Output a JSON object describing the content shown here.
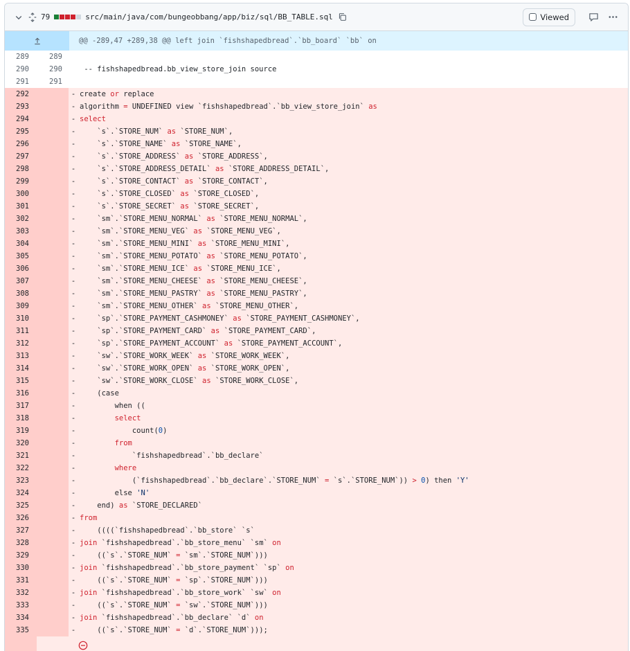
{
  "file": {
    "changed_count": "79",
    "diffstat_colors": [
      "#1a7f37",
      "#cf222e",
      "#cf222e",
      "#cf222e",
      "#d1d9e0"
    ],
    "path": "src/main/java/com/bungeobbang/app/biz/sql/BB_TABLE.sql",
    "viewed_label": "Viewed"
  },
  "hunk": "@@ -289,47 +289,38 @@ left join `fishshapedbread`.`bb_board` `bb` on",
  "context_lines": [
    {
      "old": "289",
      "new": "289",
      "text": ""
    },
    {
      "old": "290",
      "new": "290",
      "text": "-- fishshapedbread.bb_view_store_join source"
    },
    {
      "old": "291",
      "new": "291",
      "text": ""
    }
  ],
  "deleted_lines": [
    {
      "num": "292",
      "tokens": [
        [
          "p",
          "create "
        ],
        [
          "k",
          "or"
        ],
        [
          "p",
          " replace"
        ]
      ]
    },
    {
      "num": "293",
      "tokens": [
        [
          "p",
          "algorithm "
        ],
        [
          "k",
          "="
        ],
        [
          "p",
          " UNDEFINED view `fishshapedbread`.`bb_view_store_join` "
        ],
        [
          "k",
          "as"
        ]
      ]
    },
    {
      "num": "294",
      "tokens": [
        [
          "k",
          "select"
        ]
      ]
    },
    {
      "num": "295",
      "tokens": [
        [
          "p",
          "    `s`.`STORE_NUM` "
        ],
        [
          "k",
          "as"
        ],
        [
          "p",
          " `STORE_NUM`,"
        ]
      ]
    },
    {
      "num": "296",
      "tokens": [
        [
          "p",
          "    `s`.`STORE_NAME` "
        ],
        [
          "k",
          "as"
        ],
        [
          "p",
          " `STORE_NAME`,"
        ]
      ]
    },
    {
      "num": "297",
      "tokens": [
        [
          "p",
          "    `s`.`STORE_ADDRESS` "
        ],
        [
          "k",
          "as"
        ],
        [
          "p",
          " `STORE_ADDRESS`,"
        ]
      ]
    },
    {
      "num": "298",
      "tokens": [
        [
          "p",
          "    `s`.`STORE_ADDRESS_DETAIL` "
        ],
        [
          "k",
          "as"
        ],
        [
          "p",
          " `STORE_ADDRESS_DETAIL`,"
        ]
      ]
    },
    {
      "num": "299",
      "tokens": [
        [
          "p",
          "    `s`.`STORE_CONTACT` "
        ],
        [
          "k",
          "as"
        ],
        [
          "p",
          " `STORE_CONTACT`,"
        ]
      ]
    },
    {
      "num": "300",
      "tokens": [
        [
          "p",
          "    `s`.`STORE_CLOSED` "
        ],
        [
          "k",
          "as"
        ],
        [
          "p",
          " `STORE_CLOSED`,"
        ]
      ]
    },
    {
      "num": "301",
      "tokens": [
        [
          "p",
          "    `s`.`STORE_SECRET` "
        ],
        [
          "k",
          "as"
        ],
        [
          "p",
          " `STORE_SECRET`,"
        ]
      ]
    },
    {
      "num": "302",
      "tokens": [
        [
          "p",
          "    `sm`.`STORE_MENU_NORMAL` "
        ],
        [
          "k",
          "as"
        ],
        [
          "p",
          " `STORE_MENU_NORMAL`,"
        ]
      ]
    },
    {
      "num": "303",
      "tokens": [
        [
          "p",
          "    `sm`.`STORE_MENU_VEG` "
        ],
        [
          "k",
          "as"
        ],
        [
          "p",
          " `STORE_MENU_VEG`,"
        ]
      ]
    },
    {
      "num": "304",
      "tokens": [
        [
          "p",
          "    `sm`.`STORE_MENU_MINI` "
        ],
        [
          "k",
          "as"
        ],
        [
          "p",
          " `STORE_MENU_MINI`,"
        ]
      ]
    },
    {
      "num": "305",
      "tokens": [
        [
          "p",
          "    `sm`.`STORE_MENU_POTATO` "
        ],
        [
          "k",
          "as"
        ],
        [
          "p",
          " `STORE_MENU_POTATO`,"
        ]
      ]
    },
    {
      "num": "306",
      "tokens": [
        [
          "p",
          "    `sm`.`STORE_MENU_ICE` "
        ],
        [
          "k",
          "as"
        ],
        [
          "p",
          " `STORE_MENU_ICE`,"
        ]
      ]
    },
    {
      "num": "307",
      "tokens": [
        [
          "p",
          "    `sm`.`STORE_MENU_CHEESE` "
        ],
        [
          "k",
          "as"
        ],
        [
          "p",
          " `STORE_MENU_CHEESE`,"
        ]
      ]
    },
    {
      "num": "308",
      "tokens": [
        [
          "p",
          "    `sm`.`STORE_MENU_PASTRY` "
        ],
        [
          "k",
          "as"
        ],
        [
          "p",
          " `STORE_MENU_PASTRY`,"
        ]
      ]
    },
    {
      "num": "309",
      "tokens": [
        [
          "p",
          "    `sm`.`STORE_MENU_OTHER` "
        ],
        [
          "k",
          "as"
        ],
        [
          "p",
          " `STORE_MENU_OTHER`,"
        ]
      ]
    },
    {
      "num": "310",
      "tokens": [
        [
          "p",
          "    `sp`.`STORE_PAYMENT_CASHMONEY` "
        ],
        [
          "k",
          "as"
        ],
        [
          "p",
          " `STORE_PAYMENT_CASHMONEY`,"
        ]
      ]
    },
    {
      "num": "311",
      "tokens": [
        [
          "p",
          "    `sp`.`STORE_PAYMENT_CARD` "
        ],
        [
          "k",
          "as"
        ],
        [
          "p",
          " `STORE_PAYMENT_CARD`,"
        ]
      ]
    },
    {
      "num": "312",
      "tokens": [
        [
          "p",
          "    `sp`.`STORE_PAYMENT_ACCOUNT` "
        ],
        [
          "k",
          "as"
        ],
        [
          "p",
          " `STORE_PAYMENT_ACCOUNT`,"
        ]
      ]
    },
    {
      "num": "313",
      "tokens": [
        [
          "p",
          "    `sw`.`STORE_WORK_WEEK` "
        ],
        [
          "k",
          "as"
        ],
        [
          "p",
          " `STORE_WORK_WEEK`,"
        ]
      ]
    },
    {
      "num": "314",
      "tokens": [
        [
          "p",
          "    `sw`.`STORE_WORK_OPEN` "
        ],
        [
          "k",
          "as"
        ],
        [
          "p",
          " `STORE_WORK_OPEN`,"
        ]
      ]
    },
    {
      "num": "315",
      "tokens": [
        [
          "p",
          "    `sw`.`STORE_WORK_CLOSE` "
        ],
        [
          "k",
          "as"
        ],
        [
          "p",
          " `STORE_WORK_CLOSE`,"
        ]
      ]
    },
    {
      "num": "316",
      "tokens": [
        [
          "p",
          "    (case"
        ]
      ]
    },
    {
      "num": "317",
      "tokens": [
        [
          "p",
          "        when (("
        ]
      ]
    },
    {
      "num": "318",
      "tokens": [
        [
          "p",
          "        "
        ],
        [
          "k",
          "select"
        ]
      ]
    },
    {
      "num": "319",
      "tokens": [
        [
          "p",
          "            count("
        ],
        [
          "n",
          "0"
        ],
        [
          "p",
          ")"
        ]
      ]
    },
    {
      "num": "320",
      "tokens": [
        [
          "p",
          "        "
        ],
        [
          "k",
          "from"
        ]
      ]
    },
    {
      "num": "321",
      "tokens": [
        [
          "p",
          "            `fishshapedbread`.`bb_declare`"
        ]
      ]
    },
    {
      "num": "322",
      "tokens": [
        [
          "p",
          "        "
        ],
        [
          "k",
          "where"
        ]
      ]
    },
    {
      "num": "323",
      "tokens": [
        [
          "p",
          "            (`fishshapedbread`.`bb_declare`.`STORE_NUM` "
        ],
        [
          "k",
          "="
        ],
        [
          "p",
          " `s`.`STORE_NUM`)) "
        ],
        [
          "k",
          ">"
        ],
        [
          "p",
          " "
        ],
        [
          "n",
          "0"
        ],
        [
          "p",
          ") then "
        ],
        [
          "s",
          "'Y'"
        ]
      ]
    },
    {
      "num": "324",
      "tokens": [
        [
          "p",
          "        else "
        ],
        [
          "s",
          "'N'"
        ]
      ]
    },
    {
      "num": "325",
      "tokens": [
        [
          "p",
          "    end) "
        ],
        [
          "k",
          "as"
        ],
        [
          "p",
          " `STORE_DECLARED`"
        ]
      ]
    },
    {
      "num": "326",
      "tokens": [
        [
          "k",
          "from"
        ]
      ]
    },
    {
      "num": "327",
      "tokens": [
        [
          "p",
          "    ((((`fishshapedbread`.`bb_store` `s`"
        ]
      ]
    },
    {
      "num": "328",
      "tokens": [
        [
          "k",
          "join"
        ],
        [
          "p",
          " `fishshapedbread`.`bb_store_menu` `sm` "
        ],
        [
          "k",
          "on"
        ]
      ]
    },
    {
      "num": "329",
      "tokens": [
        [
          "p",
          "    ((`s`.`STORE_NUM` "
        ],
        [
          "k",
          "="
        ],
        [
          "p",
          " `sm`.`STORE_NUM`)))"
        ]
      ]
    },
    {
      "num": "330",
      "tokens": [
        [
          "k",
          "join"
        ],
        [
          "p",
          " `fishshapedbread`.`bb_store_payment` `sp` "
        ],
        [
          "k",
          "on"
        ]
      ]
    },
    {
      "num": "331",
      "tokens": [
        [
          "p",
          "    ((`s`.`STORE_NUM` "
        ],
        [
          "k",
          "="
        ],
        [
          "p",
          " `sp`.`STORE_NUM`)))"
        ]
      ]
    },
    {
      "num": "332",
      "tokens": [
        [
          "k",
          "join"
        ],
        [
          "p",
          " `fishshapedbread`.`bb_store_work` `sw` "
        ],
        [
          "k",
          "on"
        ]
      ]
    },
    {
      "num": "333",
      "tokens": [
        [
          "p",
          "    ((`s`.`STORE_NUM` "
        ],
        [
          "k",
          "="
        ],
        [
          "p",
          " `sw`.`STORE_NUM`)))"
        ]
      ]
    },
    {
      "num": "334",
      "tokens": [
        [
          "k",
          "join"
        ],
        [
          "p",
          " `fishshapedbread`.`bb_declare` `d` "
        ],
        [
          "k",
          "on"
        ]
      ]
    },
    {
      "num": "335",
      "tokens": [
        [
          "p",
          "    ((`s`.`STORE_NUM` "
        ],
        [
          "k",
          "="
        ],
        [
          "p",
          " `d`.`STORE_NUM`)));"
        ]
      ]
    }
  ],
  "deleted_marker": "-"
}
